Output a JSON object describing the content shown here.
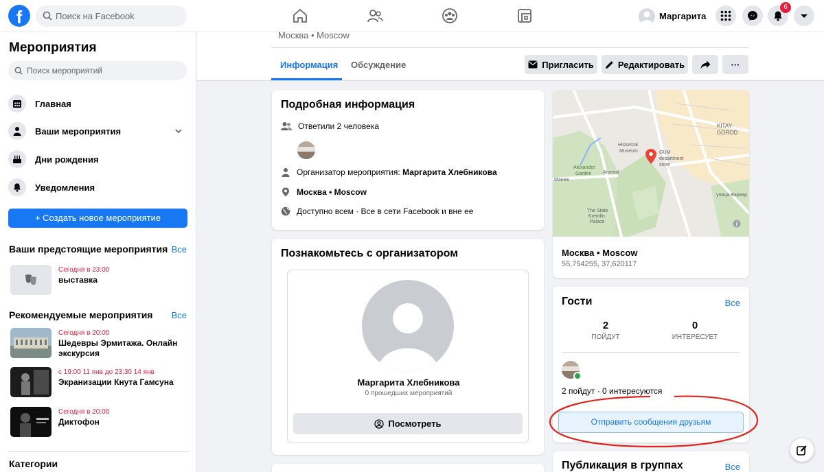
{
  "topbar": {
    "search_placeholder": "Поиск на Facebook",
    "user_name": "Маргарита",
    "notification_count": "6"
  },
  "sidebar": {
    "title": "Мероприятия",
    "search_placeholder": "Поиск мероприятий",
    "menu": [
      {
        "label": "Главная"
      },
      {
        "label": "Ваши мероприятия"
      },
      {
        "label": "Дни рождения"
      },
      {
        "label": "Уведомления"
      }
    ],
    "create_button": "Создать новое мероприятие",
    "upcoming": {
      "heading": "Ваши предстоящие мероприятия",
      "all": "Все",
      "items": [
        {
          "when": "Сегодня в 23:00",
          "title": "выставка"
        }
      ]
    },
    "recommended": {
      "heading": "Рекомендуемые мероприятия",
      "all": "Все",
      "items": [
        {
          "when": "Сегодня в 20:00",
          "title": "Шедевры Эрмитажа. Онлайн экскурсия"
        },
        {
          "when": "с 19:00 11 янв до 23:30 14 янв",
          "title": "Экранизации Кнута Гамсуна"
        },
        {
          "when": "Сегодня в 20:00",
          "title": "Диктофон"
        }
      ]
    },
    "categories": "Категории"
  },
  "event_header": {
    "location": "Москва • Moscow",
    "tabs": [
      "Информация",
      "Обсуждение"
    ],
    "buttons": {
      "invite": "Пригласить",
      "edit": "Редактировать",
      "more": "···"
    }
  },
  "details": {
    "title": "Подробная информация",
    "responded": "Ответили 2 человека",
    "organizer_label": "Организатор мероприятия:",
    "organizer_name": "Маргарита Хлебникова",
    "location": "Москва • Moscow",
    "privacy": "Доступно всем · Все в сети Facebook и вне ее"
  },
  "organizer_card": {
    "title": "Познакомьтесь с организатором",
    "name": "Маргарита Хлебникова",
    "past_events": "0 прошедших мероприятий",
    "view_button": "Посмотреть"
  },
  "map": {
    "place": "Москва • Moscow",
    "coords": "55,754255, 37,620117",
    "labels": {
      "kitay": "KITAY-",
      "gorod": "GOROD",
      "museum1": "Historical",
      "museum2": "Museum",
      "gum1": "GUM",
      "gum2": "department",
      "gum3": "store",
      "alex1": "Alexander",
      "alex2": "Garden",
      "arsenal": "Arsenal",
      "kremlin1": "The State",
      "kremlin2": "Kremlin",
      "kremlin3": "Palace",
      "manezh": "Манеж",
      "varvarka": "улица Варвар"
    }
  },
  "guests": {
    "title": "Гости",
    "all": "Все",
    "going_count": "2",
    "going_label": "ПОЙДУТ",
    "interested_count": "0",
    "interested_label": "ИНТЕРЕСУЕТ",
    "summary": "2 пойдут · 0 интересуются",
    "message_button": "Отправить сообщения друзьям"
  },
  "groups": {
    "title": "Публикация в группах",
    "all": "Все"
  },
  "colors": {
    "brand": "#1877f2",
    "notification": "#e41e3f",
    "annotation": "#e0241c"
  }
}
